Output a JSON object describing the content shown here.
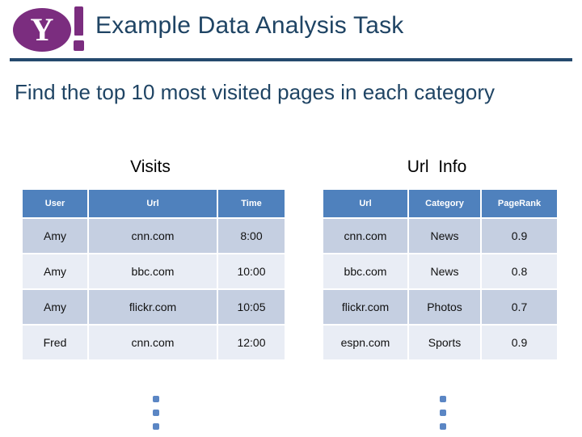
{
  "header": {
    "logo_name": "yahoo-logo",
    "logo_letter": "Y",
    "title": "Example Data Analysis Task",
    "title_color": "#1f4464",
    "rule_color": "#254a6e",
    "logo_color": "#7b2d7f"
  },
  "subtitle": {
    "text": "Find the top 10 most visited pages in each category"
  },
  "tables": [
    {
      "id": "visits",
      "caption": "Visits",
      "headers": [
        "User",
        "Url",
        "Time"
      ],
      "rows": [
        [
          "Amy",
          "cnn.com",
          "8:00"
        ],
        [
          "Amy",
          "bbc.com",
          "10:00"
        ],
        [
          "Amy",
          "flickr.com",
          "10:05"
        ],
        [
          "Fred",
          "cnn.com",
          "12:00"
        ]
      ],
      "continuation": "vertical-ellipsis"
    },
    {
      "id": "urlinfo",
      "caption": "Url  Info",
      "headers": [
        "Url",
        "Category",
        "PageRank"
      ],
      "rows": [
        [
          "cnn.com",
          "News",
          "0.9"
        ],
        [
          "bbc.com",
          "News",
          "0.8"
        ],
        [
          "flickr.com",
          "Photos",
          "0.7"
        ],
        [
          "espn.com",
          "Sports",
          "0.9"
        ]
      ],
      "continuation": "vertical-ellipsis"
    }
  ],
  "colors": {
    "header_blue": "#4f81bd",
    "row_dark": "#c5cfe1",
    "row_light": "#e9edf5",
    "dot_blue": "#5b86c4"
  }
}
